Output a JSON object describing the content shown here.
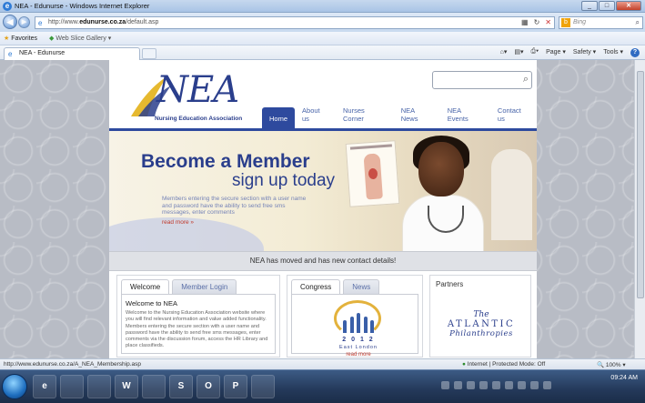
{
  "window": {
    "title": "NEA - Edunurse - Windows Internet Explorer",
    "controls": [
      "_",
      "□",
      "✕"
    ]
  },
  "address_bar": {
    "url_prefix": "http://www.",
    "url_domain": "edunurse.co.za",
    "url_suffix": "/default.asp",
    "search_placeholder": "Bing"
  },
  "favorites_bar": {
    "favorites_label": "Favorites",
    "web_slice_label": "Web Slice Gallery ▾"
  },
  "tab": {
    "label": "NEA - Edunurse"
  },
  "commands": {
    "page": "Page ▾",
    "safety": "Safety ▾",
    "tools": "Tools ▾"
  },
  "site": {
    "logo_text": "NEA",
    "logo_tagline": "Nursing Education Association",
    "search_placeholder": "",
    "nav": [
      "Home",
      "About us",
      "Nurses Corner",
      "NEA News",
      "NEA Events",
      "Contact us"
    ],
    "active_nav": "Home",
    "banner": {
      "headline": "Become a Member",
      "subheadline": "sign up today",
      "body": "Members entering the secure section with a user name and password have the ability to send free sms messages, enter comments",
      "read_more": "read more »"
    },
    "notice": "NEA has moved and has new contact details!",
    "welcome_panel": {
      "tabs": [
        "Welcome",
        "Member Login"
      ],
      "heading": "Welcome to NEA",
      "body": "Welcome to the Nursing Education Association website where you will find relevant information and value added functionality. Members entering the secure section with a user name and password have the ability to send free sms messages, enter comments via the discussion forum, access the HR Library and place classifieds."
    },
    "congress_panel": {
      "tabs": [
        "Congress",
        "News"
      ],
      "year": "2 0 1 2",
      "location": "East London",
      "read_more": "read more"
    },
    "partners_panel": {
      "title": "Partners",
      "partner_the": "The",
      "partner_name": "ATLANTIC",
      "partner_sub": "Philanthropies"
    }
  },
  "status_bar": {
    "url": "http://www.edunurse.co.za/A_NEA_Membership.asp",
    "zone": "Internet | Protected Mode: Off",
    "zoom": "100%"
  },
  "taskbar": {
    "apps": [
      "e",
      "",
      "",
      "W",
      "",
      "S",
      "O",
      "P",
      ""
    ],
    "clock": "09:24 AM"
  },
  "colors": {
    "brand_blue": "#2a3e8c",
    "nav_active": "#2e4a9e",
    "link_red": "#c0392b"
  }
}
